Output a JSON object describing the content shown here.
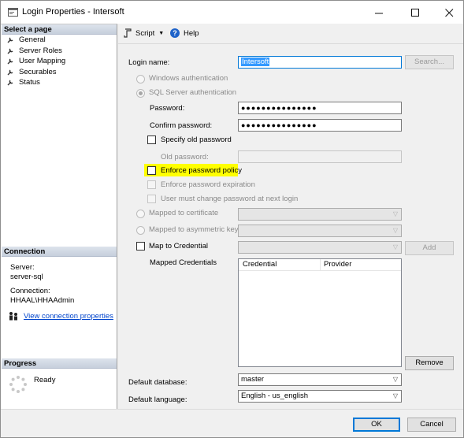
{
  "window": {
    "title": "Login Properties - Intersoft",
    "minimize_icon": "minimize-icon",
    "maximize_icon": "maximize-icon",
    "close_icon": "close-icon"
  },
  "sidebar": {
    "select_page_header": "Select a page",
    "pages": [
      {
        "label": "General"
      },
      {
        "label": "Server Roles"
      },
      {
        "label": "User Mapping"
      },
      {
        "label": "Securables"
      },
      {
        "label": "Status"
      }
    ],
    "connection_header": "Connection",
    "server_label": "Server:",
    "server_value": "server-sql",
    "connection_label": "Connection:",
    "connection_value": "HHAAL\\HHAAdmin",
    "view_connection_link": "View connection properties",
    "progress_header": "Progress",
    "progress_status": "Ready"
  },
  "toolbar": {
    "script_label": "Script",
    "help_label": "Help"
  },
  "general": {
    "login_name_label": "Login name:",
    "login_name_value": "Intersoft",
    "search_button": "Search...",
    "windows_auth_label": "Windows authentication",
    "sql_auth_label": "SQL Server authentication",
    "password_label": "Password:",
    "password_value": "●●●●●●●●●●●●●●●",
    "confirm_password_label": "Confirm password:",
    "confirm_password_value": "●●●●●●●●●●●●●●●",
    "specify_old_password_label": "Specify old password",
    "old_password_label": "Old password:",
    "enforce_policy_label": "Enforce password policy",
    "enforce_expiration_label": "Enforce password expiration",
    "must_change_label": "User must change password at next login",
    "mapped_certificate_label": "Mapped to certificate",
    "mapped_asym_key_label": "Mapped to asymmetric key",
    "map_credential_label": "Map to Credential",
    "add_button": "Add",
    "mapped_credentials_label": "Mapped Credentials",
    "credentials_columns": [
      "Credential",
      "Provider"
    ],
    "remove_button": "Remove",
    "default_database_label": "Default database:",
    "default_database_value": "master",
    "default_language_label": "Default language:",
    "default_language_value": "English - us_english"
  },
  "footer": {
    "ok_button": "OK",
    "cancel_button": "Cancel"
  },
  "colors": {
    "highlight": "#ffff00",
    "selection": "#3399ff",
    "link": "#0044cc",
    "help_icon": "#1e63c9"
  }
}
